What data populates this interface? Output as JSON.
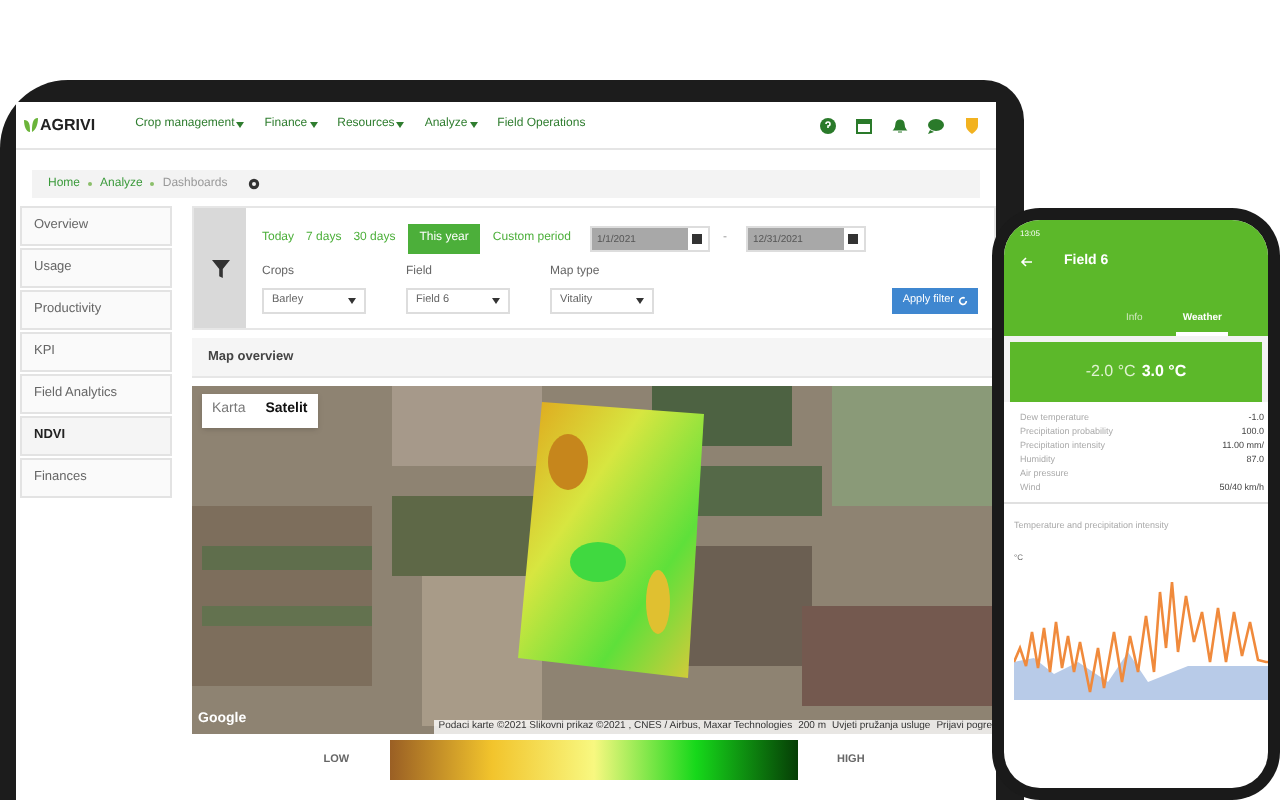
{
  "nav": {
    "logo": "AGRIVI",
    "menu": [
      {
        "label": "Crop management",
        "dropdown": true
      },
      {
        "label": "Finance",
        "dropdown": true
      },
      {
        "label": "Resources",
        "dropdown": true
      },
      {
        "label": "Analyze",
        "dropdown": true
      },
      {
        "label": "Field Operations",
        "dropdown": false
      }
    ]
  },
  "breadcrumb": [
    "Home",
    "Analyze",
    "Dashboards"
  ],
  "sidebar": {
    "items": [
      {
        "label": "Overview",
        "selected": false
      },
      {
        "label": "Usage",
        "selected": false
      },
      {
        "label": "Productivity",
        "selected": false
      },
      {
        "label": "KPI",
        "selected": false
      },
      {
        "label": "Field Analytics",
        "selected": false
      },
      {
        "label": "NDVI",
        "selected": true
      },
      {
        "label": "Finances",
        "selected": false
      }
    ]
  },
  "filter": {
    "periods": [
      {
        "label": "Today",
        "selected": false
      },
      {
        "label": "7 days",
        "selected": false
      },
      {
        "label": "30 days",
        "selected": false
      },
      {
        "label": "This year",
        "selected": true
      },
      {
        "label": "Custom period",
        "selected": false
      }
    ],
    "date_from": "1/1/2021",
    "separator": "-",
    "date_to": "12/31/2021",
    "selects": [
      {
        "label": "Crops",
        "value": "Barley"
      },
      {
        "label": "Field",
        "value": "Field 6"
      },
      {
        "label": "Map type",
        "value": "Vitality"
      }
    ],
    "apply_button": "Apply filter"
  },
  "map_overview": {
    "title": "Map overview",
    "map_types": [
      {
        "label": "Karta",
        "selected": false
      },
      {
        "label": "Satelit",
        "selected": true
      }
    ],
    "google": "Google",
    "attribution": "Podaci karte ©2021 Slikovni prikaz ©2021 , CNES / Airbus, Maxar Technologies",
    "scale": "200 m",
    "terms": "Uvjeti pružanja usluge",
    "report": "Prijavi pogre",
    "legend": {
      "low": "LOW",
      "high": "HIGH"
    }
  },
  "phone": {
    "time": "13:05",
    "title": "Field 6",
    "tabs": [
      {
        "label": "Info",
        "selected": false
      },
      {
        "label": "Weather",
        "selected": true
      }
    ],
    "temp_min": "-2.0 °C",
    "temp_max": "3.0 °C",
    "rows": [
      {
        "label": "Dew temperature",
        "value": "-1.0"
      },
      {
        "label": "Precipitation probability",
        "value": "100.0"
      },
      {
        "label": "Precipitation intensity",
        "value": "11.00 mm/"
      },
      {
        "label": "Humidity",
        "value": "87.0"
      },
      {
        "label": "Air pressure"
      },
      {
        "label": "Wind",
        "value": "50/40 km/h"
      }
    ],
    "chart_title": "Temperature and precipitation intensity",
    "chart_unit": "°C"
  }
}
